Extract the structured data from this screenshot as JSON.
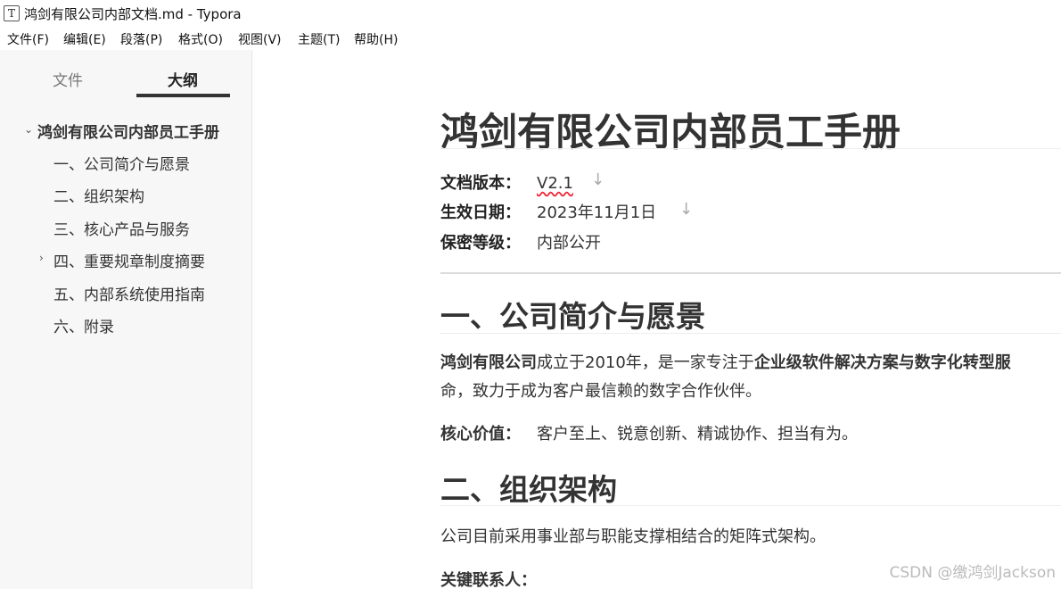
{
  "window": {
    "app_icon": "T",
    "title": "鸿剑有限公司内部文档.md - Typora"
  },
  "menu": [
    "文件(F)",
    "编辑(E)",
    "段落(P)",
    "格式(O)",
    "视图(V)",
    "主题(T)",
    "帮助(H)"
  ],
  "sidebar": {
    "tabs": [
      "文件",
      "大纲"
    ],
    "active_tab": "大纲",
    "outline": {
      "root": "鸿剑有限公司内部员工手册",
      "items": [
        "一、公司简介与愿景",
        "二、组织架构",
        "三、核心产品与服务",
        "四、重要规章制度摘要",
        "五、内部系统使用指南",
        "六、附录"
      ]
    }
  },
  "document": {
    "title": "鸿剑有限公司内部员工手册",
    "meta": [
      {
        "label": "文档版本：",
        "value": "V2.1"
      },
      {
        "label": "生效日期：",
        "value": "2023年11月1日"
      },
      {
        "label": "保密等级：",
        "value": "内部公开"
      }
    ],
    "section1": {
      "heading": "一、公司简介与愿景",
      "p1_bold1": "鸿剑有限公司",
      "p1_text1": "成立于2010年，是一家专注于",
      "p1_bold2": "企业级软件解决方案与数字化转型服",
      "p1_line2": "命，致力于成为客户最信赖的数字合作伙伴。",
      "values_label": "核心价值：",
      "values_text": "客户至上、锐意创新、精诚协作、担当有为。"
    },
    "section2": {
      "heading": "二、组织架构",
      "p1": "公司目前采用事业部与职能支撑相结合的矩阵式架构。",
      "contacts_label": "关键联系人："
    }
  },
  "watermark": "CSDN @缴鸿剑Jackson"
}
